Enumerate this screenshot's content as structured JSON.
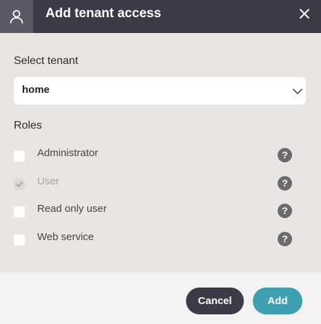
{
  "header": {
    "title": "Add tenant access",
    "user_icon": "user-icon",
    "close_icon": "close-icon"
  },
  "tenant_select": {
    "label": "Select tenant",
    "value": "home",
    "chevron_icon": "chevron-down-icon"
  },
  "roles": {
    "label": "Roles",
    "items": [
      {
        "label": "Administrator",
        "checked": false,
        "disabled": false
      },
      {
        "label": "User",
        "checked": true,
        "disabled": true
      },
      {
        "label": "Read only user",
        "checked": false,
        "disabled": false
      },
      {
        "label": "Web service",
        "checked": false,
        "disabled": false
      }
    ],
    "help_icon": "?"
  },
  "footer": {
    "cancel_label": "Cancel",
    "add_label": "Add"
  },
  "colors": {
    "header_bg": "#3d3a47",
    "accent": "#3d9fb0",
    "body_bg": "#e9e5e2"
  }
}
